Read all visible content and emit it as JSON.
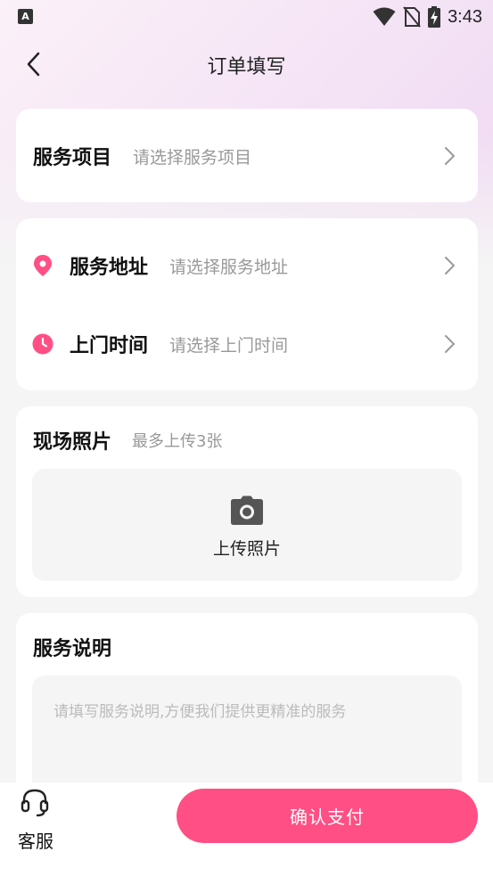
{
  "status_bar": {
    "time": "3:43",
    "app_icon_letter": "A"
  },
  "nav": {
    "title": "订单填写"
  },
  "service_item": {
    "label": "服务项目",
    "placeholder": "请选择服务项目"
  },
  "address": {
    "label": "服务地址",
    "placeholder": "请选择服务地址"
  },
  "visit_time": {
    "label": "上门时间",
    "placeholder": "请选择上门时间"
  },
  "photos": {
    "title": "现场照片",
    "hint": "最多上传3张",
    "upload_label": "上传照片"
  },
  "description": {
    "title": "服务说明",
    "placeholder": "请填写服务说明,方便我们提供更精准的服务"
  },
  "bottom": {
    "service_label": "客服",
    "pay_label": "确认支付"
  },
  "colors": {
    "accent": "#ff4f84",
    "background": "#f5f5f5",
    "card": "#ffffff"
  },
  "icons": [
    "app-icon",
    "wifi-icon",
    "no-sim-icon",
    "battery-charging-icon",
    "back-icon",
    "chevron-right-icon",
    "location-pin-icon",
    "clock-icon",
    "camera-icon",
    "headset-icon"
  ]
}
